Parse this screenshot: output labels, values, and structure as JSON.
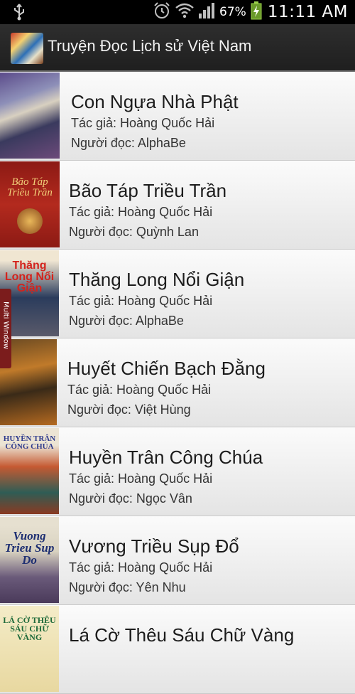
{
  "status_bar": {
    "battery_percent": "67%",
    "time": "11:11 AM",
    "icons": [
      "usb-icon",
      "alarm-icon",
      "wifi-icon",
      "signal-icon",
      "battery-charging-icon"
    ]
  },
  "app_bar": {
    "title": "Truyện Đọc Lịch sử Việt Nam",
    "icon": "app-logo-icon"
  },
  "multi_window": {
    "label": "Multi Window"
  },
  "books": [
    {
      "title": "Con Ngựa Nhà Phật",
      "author": "Tác giả: Hoàng Quốc Hải",
      "reader": "Người đọc: AlphaBe",
      "cover_text": ""
    },
    {
      "title": "Bão Táp Triều Trần",
      "author": "Tác giả: Hoàng Quốc Hải",
      "reader": "Người đọc: Quỳnh Lan",
      "cover_text": "Bão Táp Triều Trần"
    },
    {
      "title": "Thăng Long Nổi Giận",
      "author": "Tác giả: Hoàng Quốc Hải",
      "reader": "Người đọc: AlphaBe",
      "cover_text": "Thăng Long Nổi Giận"
    },
    {
      "title": "Huyết Chiến Bạch Đằng",
      "author": "Tác giả: Hoàng Quốc Hải",
      "reader": "Người đọc: Việt Hùng",
      "cover_text": ""
    },
    {
      "title": "Huyền Trân Công Chúa",
      "author": "Tác giả: Hoàng Quốc Hải",
      "reader": "Người đọc: Ngọc Vân",
      "cover_text": "HUYỀN TRÂN CÔNG CHÚA"
    },
    {
      "title": "Vương Triều Sụp Đổ",
      "author": "Tác giả: Hoàng Quốc Hải",
      "reader": "Người đọc: Yên Nhu",
      "cover_text": "Vuong Trieu Sup Do"
    },
    {
      "title": "Lá Cờ Thêu Sáu Chữ Vàng",
      "author": "",
      "reader": "",
      "cover_text": "LÁ CỜ THÊU SÁU CHỮ VÀNG"
    }
  ]
}
